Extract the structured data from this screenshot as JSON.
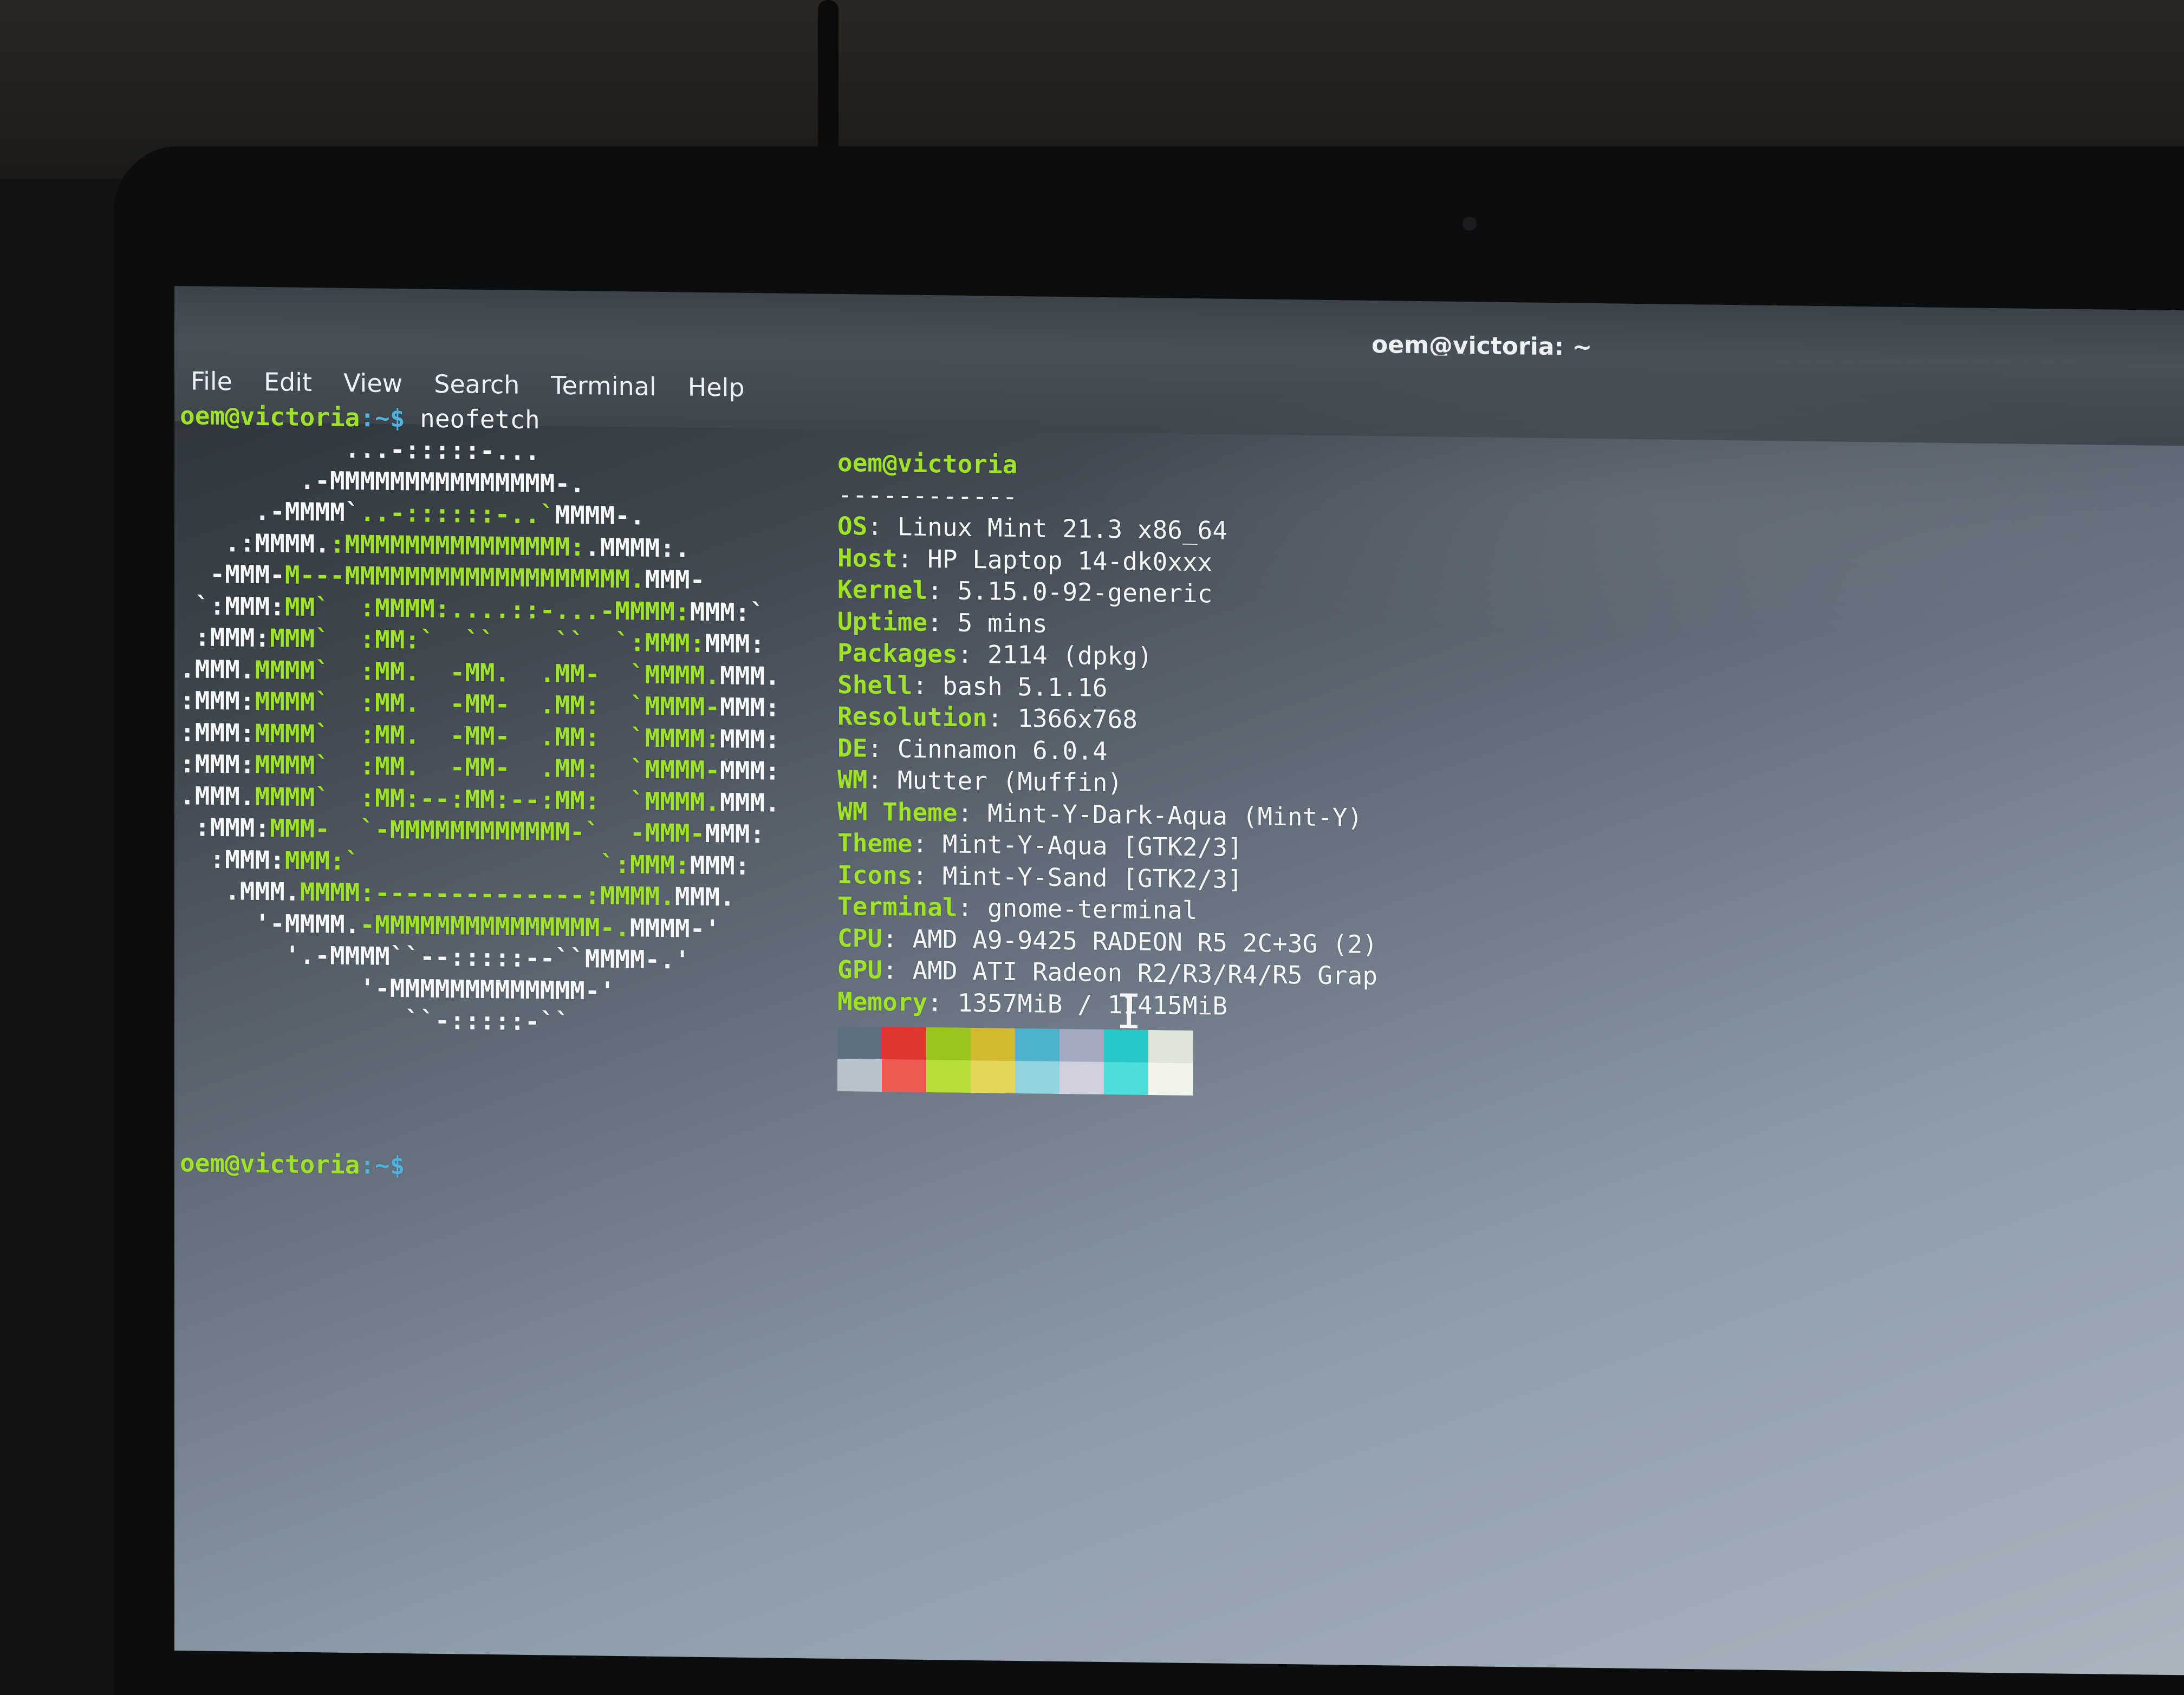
{
  "window": {
    "title": "oem@victoria: ~"
  },
  "menu": [
    "File",
    "Edit",
    "View",
    "Search",
    "Terminal",
    "Help"
  ],
  "prompt": {
    "user_host": "oem@victoria",
    "suffix": ":~$"
  },
  "command": "neofetch",
  "logo_lines": [
    [
      [
        "w",
        "           ...-:::::-..."
      ]
    ],
    [
      [
        "w",
        "        .-MMMMMMMMMMMMMMM-."
      ]
    ],
    [
      [
        "w",
        "     .-MMMM`"
      ],
      [
        "g",
        "..-::::::-..`"
      ],
      [
        "w",
        "MMMM-."
      ]
    ],
    [
      [
        "w",
        "   .:MMMM."
      ],
      [
        "g",
        ":MMMMMMMMMMMMMMM:"
      ],
      [
        "w",
        ".MMMM:."
      ]
    ],
    [
      [
        "w",
        "  -MMM-"
      ],
      [
        "g",
        "M---MMMMMMMMMMMMMMMMMMM."
      ],
      [
        "w",
        "MMM-"
      ]
    ],
    [
      [
        "w",
        " `:MMM:"
      ],
      [
        "g",
        "MM`  :MMMM:....::-...-MMMM:"
      ],
      [
        "w",
        "MMM:`"
      ]
    ],
    [
      [
        "w",
        " :MMM:"
      ],
      [
        "g",
        "MMM`  :MM:`  ``    ``  `:MMM:"
      ],
      [
        "w",
        "MMM:"
      ]
    ],
    [
      [
        "w",
        ".MMM."
      ],
      [
        "g",
        "MMMM`  :MM.  -MM.  .MM-  `MMMM."
      ],
      [
        "w",
        "MMM."
      ]
    ],
    [
      [
        "w",
        ":MMM:"
      ],
      [
        "g",
        "MMMM`  :MM.  -MM-  .MM:  `MMMM-"
      ],
      [
        "w",
        "MMM:"
      ]
    ],
    [
      [
        "w",
        ":MMM:"
      ],
      [
        "g",
        "MMMM`  :MM.  -MM-  .MM:  `MMMM:"
      ],
      [
        "w",
        "MMM:"
      ]
    ],
    [
      [
        "w",
        ":MMM:"
      ],
      [
        "g",
        "MMMM`  :MM.  -MM-  .MM:  `MMMM-"
      ],
      [
        "w",
        "MMM:"
      ]
    ],
    [
      [
        "w",
        ".MMM."
      ],
      [
        "g",
        "MMMM`  :MM:--:MM:--:MM:  `MMMM."
      ],
      [
        "w",
        "MMM."
      ]
    ],
    [
      [
        "w",
        " :MMM:"
      ],
      [
        "g",
        "MMM-  `-MMMMMMMMMMMM-`  -MMM-"
      ],
      [
        "w",
        "MMM:"
      ]
    ],
    [
      [
        "w",
        "  :MMM:"
      ],
      [
        "g",
        "MMM:`                `:MMM:"
      ],
      [
        "w",
        "MMM:"
      ]
    ],
    [
      [
        "w",
        "   .MMM."
      ],
      [
        "g",
        "MMMM:--------------:MMMM."
      ],
      [
        "w",
        "MMM."
      ]
    ],
    [
      [
        "w",
        "     '-MMMM."
      ],
      [
        "g",
        "-MMMMMMMMMMMMMMM-."
      ],
      [
        "w",
        "MMMM-'"
      ]
    ],
    [
      [
        "w",
        "       '.-MMMM``--:::::--``MMMM-.'"
      ]
    ],
    [
      [
        "w",
        "            '-MMMMMMMMMMMMM-'"
      ]
    ],
    [
      [
        "w",
        "               ``-:::::-``"
      ]
    ]
  ],
  "info": {
    "header": "oem@victoria",
    "separator": "------------",
    "rows": [
      {
        "key": "OS",
        "value": "Linux Mint 21.3 x86_64"
      },
      {
        "key": "Host",
        "value": "HP Laptop 14-dk0xxx"
      },
      {
        "key": "Kernel",
        "value": "5.15.0-92-generic"
      },
      {
        "key": "Uptime",
        "value": "5 mins"
      },
      {
        "key": "Packages",
        "value": "2114 (dpkg)"
      },
      {
        "key": "Shell",
        "value": "bash 5.1.16"
      },
      {
        "key": "Resolution",
        "value": "1366x768"
      },
      {
        "key": "DE",
        "value": "Cinnamon 6.0.4"
      },
      {
        "key": "WM",
        "value": "Mutter (Muffin)"
      },
      {
        "key": "WM Theme",
        "value": "Mint-Y-Dark-Aqua (Mint-Y)"
      },
      {
        "key": "Theme",
        "value": "Mint-Y-Aqua [GTK2/3]"
      },
      {
        "key": "Icons",
        "value": "Mint-Y-Sand [GTK2/3]"
      },
      {
        "key": "Terminal",
        "value": "gnome-terminal"
      },
      {
        "key": "CPU",
        "value": "AMD A9-9425 RADEON R5 2C+3G (2)"
      },
      {
        "key": "GPU",
        "value": "AMD ATI Radeon R2/R3/R4/R5 Grap"
      },
      {
        "key": "Memory",
        "value": "1357MiB / 11415MiB"
      }
    ]
  },
  "palette": {
    "top": [
      "#5d7080",
      "#e0362f",
      "#99c51d",
      "#d2b92e",
      "#4db3cc",
      "#a5a8c1",
      "#28c8c8",
      "#dde6d8"
    ],
    "bottom": [
      "#b6c3cb",
      "#ee5a52",
      "#b5de38",
      "#e3d65c",
      "#8fd4e0",
      "#cfcfde",
      "#4cdedd",
      "#f1f4ea"
    ]
  },
  "colors": {
    "prompt_green": "#9fe22a",
    "prompt_blue": "#4fb2df"
  }
}
